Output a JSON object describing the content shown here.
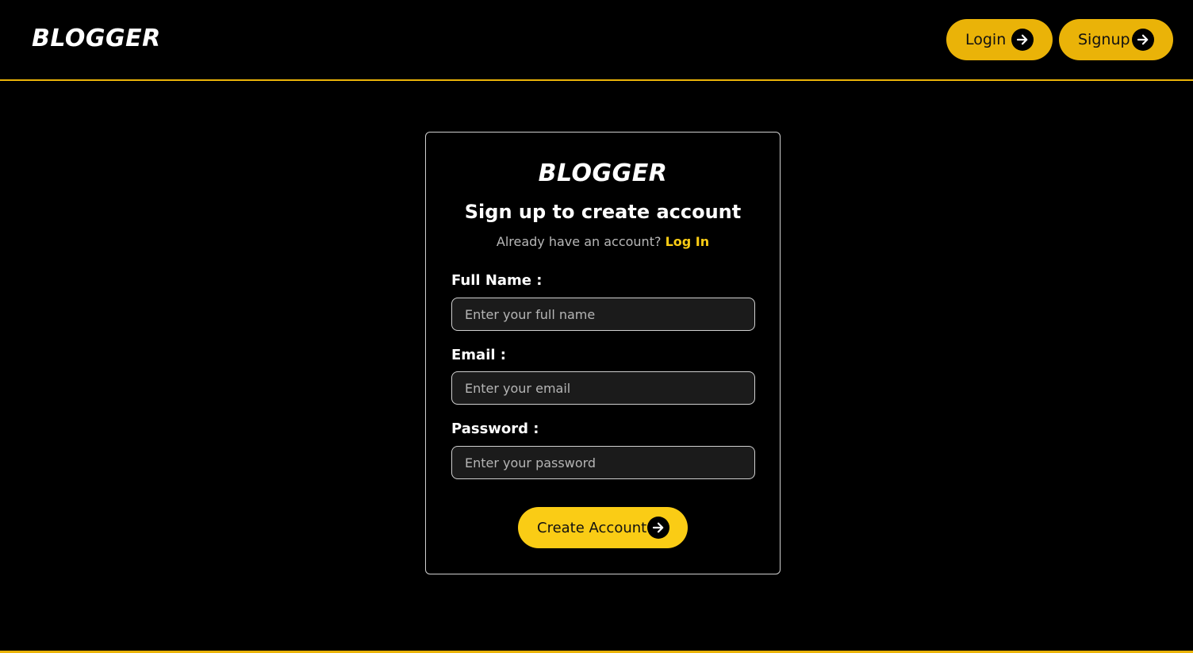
{
  "header": {
    "brand": "BLOGGER",
    "login_label": "Login",
    "signup_label": "Signup",
    "arrow_icon": "arrow-right-circle-icon"
  },
  "form": {
    "brand": "BLOGGER",
    "title": "Sign up to create account",
    "subtitle_text": "Already have an account?",
    "login_link": "Log In",
    "fields": [
      {
        "label": "Full Name :",
        "placeholder": "Enter your full name",
        "value": ""
      },
      {
        "label": "Email :",
        "placeholder": "Enter your email",
        "value": ""
      },
      {
        "label": "Password :",
        "placeholder": "Enter your password",
        "value": ""
      }
    ],
    "submit_label": "Create Account"
  },
  "colors": {
    "accent": "#eab308",
    "accent_button": "#facc15",
    "background": "#000000",
    "input_background": "#1b1b1b"
  }
}
